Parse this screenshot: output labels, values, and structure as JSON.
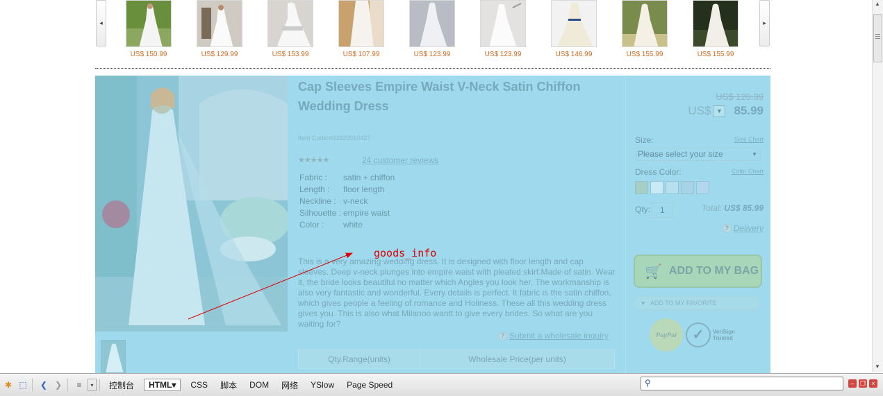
{
  "carousel": {
    "prev_icon": "chevron-left-icon",
    "next_icon": "chevron-right-icon",
    "items": [
      {
        "price": "US$ 150.99"
      },
      {
        "price": "US$ 129.99"
      },
      {
        "price": "US$ 153.99"
      },
      {
        "price": "US$ 107.99"
      },
      {
        "price": "US$ 123.99"
      },
      {
        "price": "US$ 123.99"
      },
      {
        "price": "US$ 146.99"
      },
      {
        "price": "US$ 155.99"
      },
      {
        "price": "US$ 155.99"
      }
    ]
  },
  "product": {
    "title": "Cap Sleeves Empire Waist V-Neck Satin Chiffon Wedding Dress",
    "item_code": "Item Code:#03920010427",
    "reviews": "24 customer reviews",
    "specs": [
      {
        "key": "Fabric :",
        "value": "satin + chiffon"
      },
      {
        "key": "Length :",
        "value": "floor length"
      },
      {
        "key": "Neckline :",
        "value": "v-neck"
      },
      {
        "key": "Silhouette :",
        "value": "empire waist"
      },
      {
        "key": "Color :",
        "value": "white"
      }
    ],
    "description": "This is a very amazing wedding dress. It is designed with floor length and cap sleeves. Deep v-neck plunges into empire waist with pleated skirt.Made of satin. Wear it, the bride looks beautiful no matter which Angles you look her. The workmanship is also very fantastic and wonderful. Every details is perfect. It fabric is the satin chiffon, which gives people a feeling of romance and Holiness. These all this wedding dress gives you. This is also what Milanoo wantt to give every brides. So what are you waiting for?",
    "inquiry_link": "Submit a wholesale inquiry",
    "wholesale_headers": [
      "Qty.Range(units)",
      "Wholesale Price(per units)"
    ]
  },
  "purchase": {
    "old_price": "US$ 120.39",
    "currency": "US$",
    "currency_icon": "chevron-down-icon",
    "price": "85.99",
    "size_label": "Size:",
    "size_chart": "Size Chart",
    "size_placeholder": "Please select your size",
    "color_label": "Dress Color:",
    "color_chart": "Color Chart",
    "qty_label": "Qty:",
    "qty_value": "1",
    "total_label": "Total:",
    "total_value": "US$ 85.99",
    "delivery": "Delivery",
    "add_to_bag": "ADD TO MY BAG",
    "add_to_favorite": "ADD TO MY FAVORITE",
    "paypal_badge": "PayPal",
    "verisign_line1": "VeriSign",
    "verisign_line2": "Trusted"
  },
  "annotation": {
    "label": "goods_info",
    "color": "#e00000"
  },
  "devtools": {
    "tabs": [
      "控制台",
      "HTML▾",
      "CSS",
      "脚本",
      "DOM",
      "网络",
      "YSlow",
      "Page Speed"
    ],
    "active_tab": "HTML▾"
  }
}
